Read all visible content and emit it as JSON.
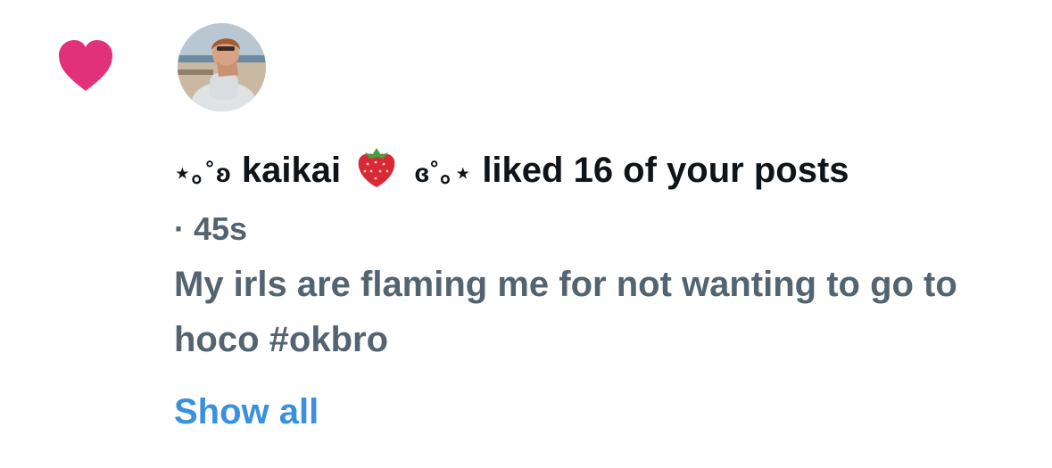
{
  "notification": {
    "icon": "heart-icon",
    "icon_color": "#e0317a",
    "avatar": "user-avatar-photo",
    "user": {
      "name_prefix": "⋆｡˚ʚ",
      "name": "kaikai",
      "name_emoji": "strawberry-icon",
      "name_suffix": "ɞ˚｡⋆"
    },
    "action_text": "liked 16 of your posts",
    "separator": "·",
    "time": "45s",
    "post_text": "My irls are flaming me for not wanting to go to hoco #okbro",
    "show_all_label": "Show all",
    "link_color": "#3a90de",
    "secondary_text_color": "#536471"
  }
}
